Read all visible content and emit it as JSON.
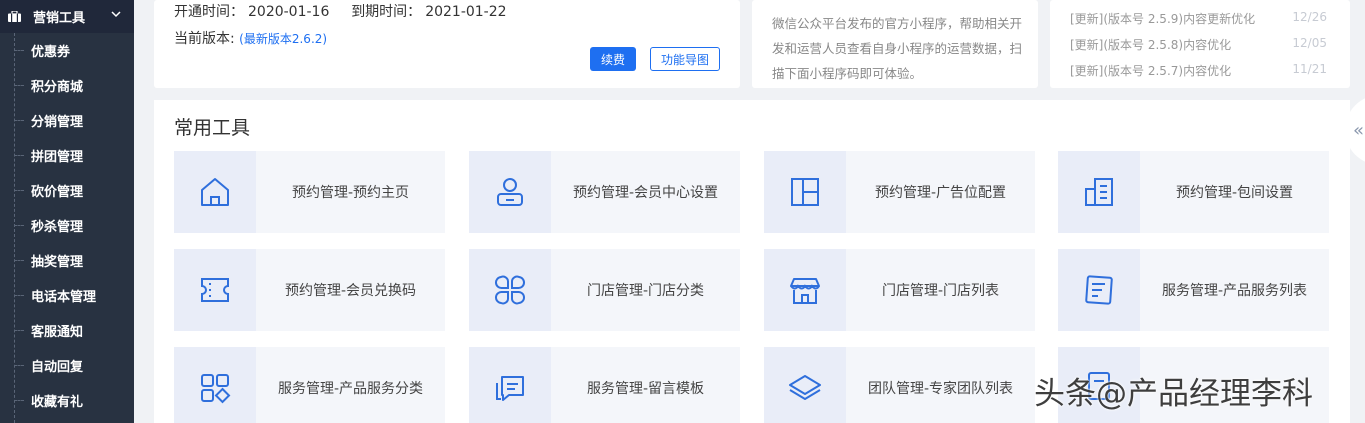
{
  "sidebar": {
    "section_title": "营销工具",
    "items": [
      {
        "label": "优惠券"
      },
      {
        "label": "积分商城"
      },
      {
        "label": "分销管理"
      },
      {
        "label": "拼团管理"
      },
      {
        "label": "砍价管理"
      },
      {
        "label": "秒杀管理"
      },
      {
        "label": "抽奖管理"
      },
      {
        "label": "电话本管理"
      },
      {
        "label": "客服通知"
      },
      {
        "label": "自动回复"
      },
      {
        "label": "收藏有礼"
      }
    ]
  },
  "account": {
    "open_label": "开通时间：",
    "open_date": "2020-01-16",
    "expire_label": "到期时间：",
    "expire_date": "2021-01-22",
    "version_label": "当前版本:",
    "version_link": "(最新版本2.6.2)",
    "renew_button": "续费",
    "feature_map_button": "功能导图"
  },
  "miniprogram": {
    "description": "微信公众平台发布的官方小程序，帮助相关开发和运营人员查看自身小程序的运营数据，扫描下面小程序码即可体验。"
  },
  "updates": [
    {
      "text": "[更新](版本号 2.5.9)内容更新优化",
      "date": "12/26"
    },
    {
      "text": "[更新](版本号 2.5.8)内容优化",
      "date": "12/05"
    },
    {
      "text": "[更新](版本号 2.5.7)内容优化",
      "date": "11/21"
    }
  ],
  "tools": {
    "title": "常用工具",
    "items": [
      {
        "label": "预约管理-预约主页",
        "icon": "home-icon"
      },
      {
        "label": "预约管理-会员中心设置",
        "icon": "member-icon"
      },
      {
        "label": "预约管理-广告位配置",
        "icon": "layout-icon"
      },
      {
        "label": "预约管理-包间设置",
        "icon": "room-icon"
      },
      {
        "label": "预约管理-会员兑换码",
        "icon": "ticket-icon"
      },
      {
        "label": "门店管理-门店分类",
        "icon": "category-icon"
      },
      {
        "label": "门店管理-门店列表",
        "icon": "store-icon"
      },
      {
        "label": "服务管理-产品服务列表",
        "icon": "list-icon"
      },
      {
        "label": "服务管理-产品服务分类",
        "icon": "apps-icon"
      },
      {
        "label": "服务管理-留言模板",
        "icon": "message-icon"
      },
      {
        "label": "团队管理-专家团队列表",
        "icon": "layers-icon"
      },
      {
        "label": "",
        "icon": "doc-icon"
      }
    ]
  },
  "watermark": "头条@产品经理李科",
  "colors": {
    "accent": "#1e6ff1",
    "sidebar": "#283241",
    "icon": "#2f6fdc"
  }
}
